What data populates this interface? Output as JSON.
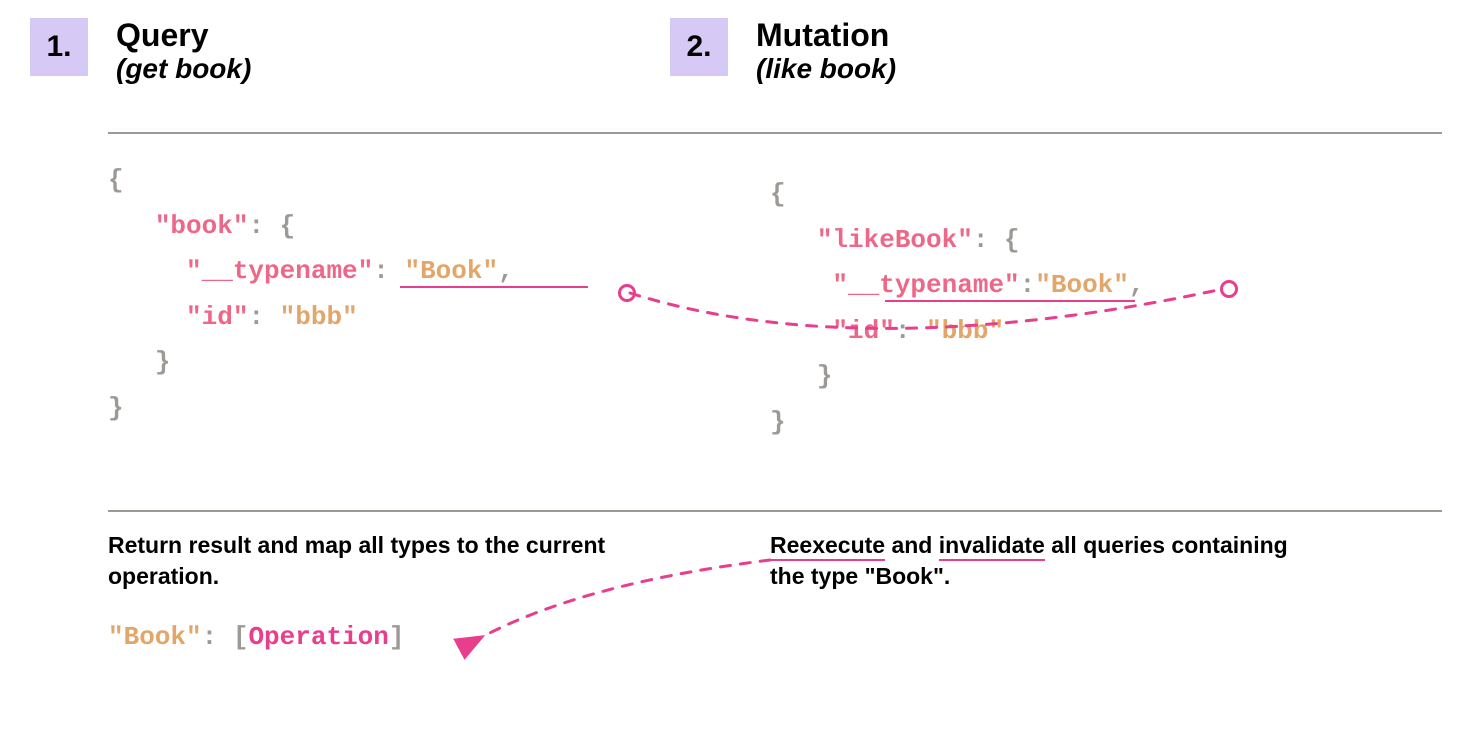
{
  "steps": {
    "one": {
      "num": "1.",
      "title": "Query",
      "sub": "(get book)"
    },
    "two": {
      "num": "2.",
      "title": "Mutation",
      "sub": "(like book)"
    }
  },
  "code_left": {
    "open": "{",
    "book_key": "\"book\"",
    "colon_brace": ": {",
    "typename_key": "\"__typename\"",
    "typename_colon": ": ",
    "typename_val": "\"Book\"",
    "comma": ",",
    "id_key": "\"id\"",
    "id_colon": ": ",
    "id_val": "\"bbb\"",
    "close_inner": "}",
    "close": "}"
  },
  "code_right": {
    "open": "{",
    "book_key": "\"likeBook\"",
    "colon_brace": ": {",
    "typename_key": "\"__typename\"",
    "typename_colon": ":",
    "typename_val": "\"Book\"",
    "comma": ",",
    "id_key": "\"id\"",
    "id_colon": ": ",
    "id_val": "\"bbb\"",
    "close_inner": "}",
    "close": "}"
  },
  "notes": {
    "left": "Return result and map all types to the current operation.",
    "right_pre": "",
    "right_a": "Reexecute",
    "right_mid": " and ",
    "right_b": "invalidate",
    "right_post": " all queries containing the type \"Book\"."
  },
  "map": {
    "key": "\"Book\"",
    "colon": ": ",
    "lbrack": "[",
    "op": "Operation",
    "rbrack": "]"
  }
}
